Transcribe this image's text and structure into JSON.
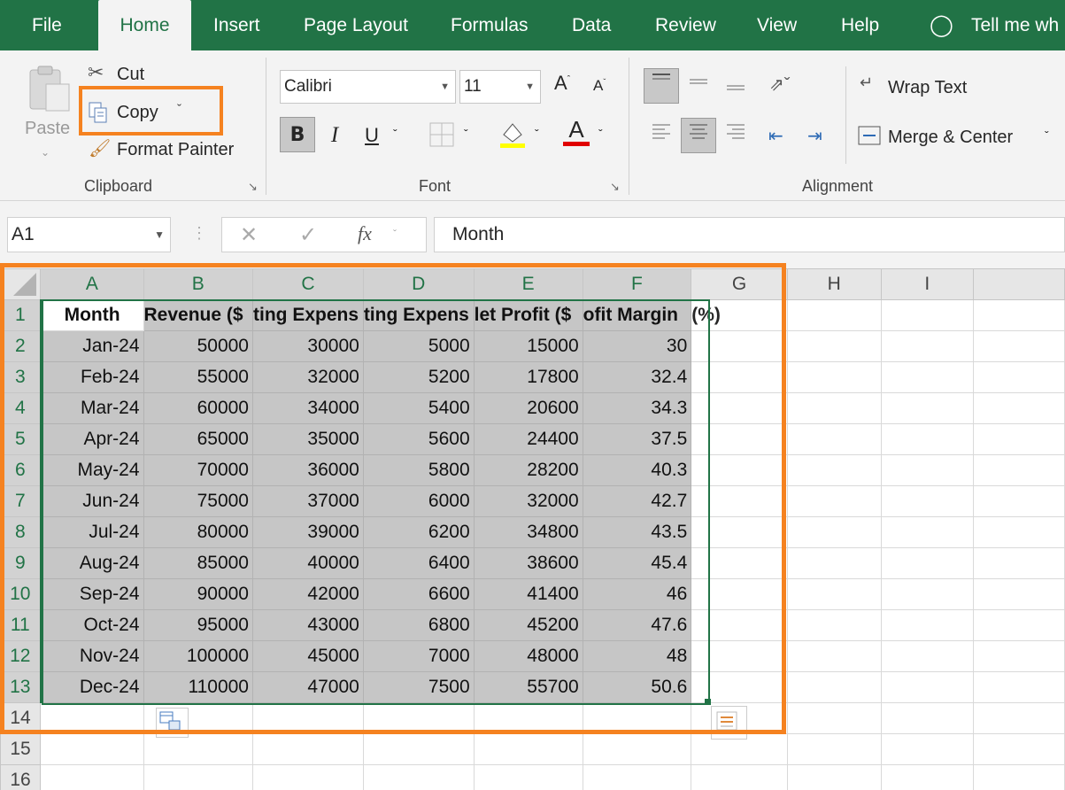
{
  "tabs": [
    "File",
    "Home",
    "Insert",
    "Page Layout",
    "Formulas",
    "Data",
    "Review",
    "View",
    "Help",
    "Tell me wh"
  ],
  "clipboard": {
    "paste": "Paste",
    "cut": "Cut",
    "copy": "Copy",
    "format_painter": "Format Painter",
    "group": "Clipboard"
  },
  "font": {
    "name": "Calibri",
    "size": "11",
    "bold": "B",
    "italic": "I",
    "underline": "U",
    "grow": "A",
    "shrink": "A",
    "color_letter": "A",
    "group": "Font"
  },
  "alignment": {
    "wrap": "Wrap Text",
    "merge": "Merge & Center",
    "group": "Alignment"
  },
  "formula_bar": {
    "name_box": "A1",
    "fx": "fx",
    "value": "Month"
  },
  "columns": [
    "A",
    "B",
    "C",
    "D",
    "E",
    "F",
    "G",
    "H",
    "I"
  ],
  "rows": [
    "1",
    "2",
    "3",
    "4",
    "5",
    "6",
    "7",
    "8",
    "9",
    "10",
    "11",
    "12",
    "13",
    "14",
    "15",
    "16"
  ],
  "headers": [
    "Month",
    "Revenue ($",
    "ting Expens",
    "ting Expens",
    "let Profit ($",
    "ofit Margin",
    "(%)"
  ],
  "data": [
    [
      "Jan-24",
      "50000",
      "30000",
      "5000",
      "15000",
      "30"
    ],
    [
      "Feb-24",
      "55000",
      "32000",
      "5200",
      "17800",
      "32.4"
    ],
    [
      "Mar-24",
      "60000",
      "34000",
      "5400",
      "20600",
      "34.3"
    ],
    [
      "Apr-24",
      "65000",
      "35000",
      "5600",
      "24400",
      "37.5"
    ],
    [
      "May-24",
      "70000",
      "36000",
      "5800",
      "28200",
      "40.3"
    ],
    [
      "Jun-24",
      "75000",
      "37000",
      "6000",
      "32000",
      "42.7"
    ],
    [
      "Jul-24",
      "80000",
      "39000",
      "6200",
      "34800",
      "43.5"
    ],
    [
      "Aug-24",
      "85000",
      "40000",
      "6400",
      "38600",
      "45.4"
    ],
    [
      "Sep-24",
      "90000",
      "42000",
      "6600",
      "41400",
      "46"
    ],
    [
      "Oct-24",
      "95000",
      "43000",
      "6800",
      "45200",
      "47.6"
    ],
    [
      "Nov-24",
      "100000",
      "45000",
      "7000",
      "48000",
      "48"
    ],
    [
      "Dec-24",
      "110000",
      "47000",
      "7500",
      "55700",
      "50.6"
    ]
  ],
  "colors": {
    "excel_green": "#217346",
    "highlight": "#f58220",
    "selection": "#c6c6c6"
  }
}
